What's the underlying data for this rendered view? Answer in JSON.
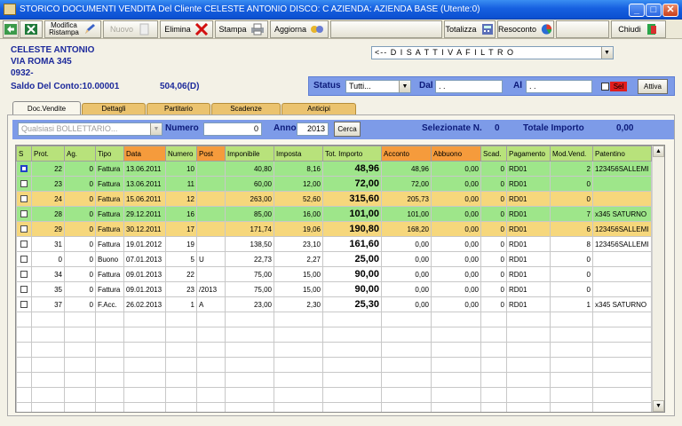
{
  "window": {
    "title": "STORICO DOCUMENTI VENDITA Del Cliente CELESTE ANTONIO   DISCO: C   AZIENDA: AZIENDA BASE (Utente:0)",
    "min": "_",
    "max": "□",
    "close": "✕"
  },
  "toolbar": {
    "modifica": "Modifica",
    "ristampa": "Ristampa",
    "nuovo": "Nuovo",
    "elimina": "Elimina",
    "stampa": "Stampa",
    "aggiorna": "Aggiorna",
    "totalizza": "Totalizza",
    "resoconto": "Resoconto",
    "chiudi": "Chiudi"
  },
  "customer": {
    "name": "CELESTE ANTONIO",
    "address": "VIA ROMA 345",
    "code": "0932-",
    "saldo_label": "Saldo Del Conto:10.00001",
    "saldo_value": "504,06(D)"
  },
  "filter_select": "<-- D I S A T T I V A   F I L T R O",
  "status_bar": {
    "status_label": "Status",
    "status_value": "Tutti...",
    "dal_label": "Dal",
    "dal_value": " .   .",
    "al_label": "Al",
    "al_value": " .   .",
    "sel_label": "Sel",
    "attiva": "Attiva"
  },
  "tabs": [
    "Doc.Vendite",
    "Dettagli",
    "Partitario",
    "Scadenze",
    "Anticipi"
  ],
  "doc_filter": {
    "tipo_placeholder": "Qualsiasi BOLLETTARIO...",
    "numero_label": "Numero",
    "numero_value": "0",
    "anno_label": "Anno",
    "anno_value": "2013",
    "cerca": "Cerca",
    "selezionate_label": "Selezionate N.",
    "selezionate_value": "0",
    "totale_label": "Totale Importo",
    "totale_value": "0,00"
  },
  "columns": [
    "S",
    "Prot.",
    "Ag.",
    "Tipo",
    "Data",
    "Numero",
    "Post",
    "Imponibile",
    "Imposta",
    "Tot. Importo",
    "Acconto",
    "Abbuono",
    "Scad.",
    "Pagamento",
    "Mod.Vend.",
    "Patentino"
  ],
  "header_colors": {
    "default": "#b8e27b",
    "orange": "#f59b3c",
    "blue": "#8ab4ea"
  },
  "row_colors": {
    "green": "#9ee68a",
    "yellow": "#f6d77c",
    "white": "#ffffff"
  },
  "rows": [
    {
      "color": "green",
      "prot": "22",
      "ag": "0",
      "tipo": "Fattura",
      "data": "13.06.2011",
      "numero": "10",
      "post": "",
      "imponibile": "40,80",
      "imposta": "8,16",
      "tot": "48,96",
      "acconto": "48,96",
      "abbuono": "0,00",
      "scad": "0",
      "pag": "RD01",
      "mod": "2",
      "pat": "123456SALLEMI"
    },
    {
      "color": "green",
      "prot": "23",
      "ag": "0",
      "tipo": "Fattura",
      "data": "13.06.2011",
      "numero": "11",
      "post": "",
      "imponibile": "60,00",
      "imposta": "12,00",
      "tot": "72,00",
      "acconto": "72,00",
      "abbuono": "0,00",
      "scad": "0",
      "pag": "RD01",
      "mod": "0",
      "pat": ""
    },
    {
      "color": "yellow",
      "prot": "24",
      "ag": "0",
      "tipo": "Fattura",
      "data": "15.06.2011",
      "numero": "12",
      "post": "",
      "imponibile": "263,00",
      "imposta": "52,60",
      "tot": "315,60",
      "acconto": "205,73",
      "abbuono": "0,00",
      "scad": "0",
      "pag": "RD01",
      "mod": "0",
      "pat": ""
    },
    {
      "color": "green",
      "prot": "28",
      "ag": "0",
      "tipo": "Fattura",
      "data": "29.12.2011",
      "numero": "16",
      "post": "",
      "imponibile": "85,00",
      "imposta": "16,00",
      "tot": "101,00",
      "acconto": "101,00",
      "abbuono": "0,00",
      "scad": "0",
      "pag": "RD01",
      "mod": "7",
      "pat": "x345 SATURNO"
    },
    {
      "color": "yellow",
      "prot": "29",
      "ag": "0",
      "tipo": "Fattura",
      "data": "30.12.2011",
      "numero": "17",
      "post": "",
      "imponibile": "171,74",
      "imposta": "19,06",
      "tot": "190,80",
      "acconto": "168,20",
      "abbuono": "0,00",
      "scad": "0",
      "pag": "RD01",
      "mod": "6",
      "pat": "123456SALLEMI"
    },
    {
      "color": "white",
      "prot": "31",
      "ag": "0",
      "tipo": "Fattura",
      "data": "19.01.2012",
      "numero": "19",
      "post": "",
      "imponibile": "138,50",
      "imposta": "23,10",
      "tot": "161,60",
      "acconto": "0,00",
      "abbuono": "0,00",
      "scad": "0",
      "pag": "RD01",
      "mod": "8",
      "pat": "123456SALLEMI"
    },
    {
      "color": "white",
      "prot": "0",
      "ag": "0",
      "tipo": "Buono",
      "data": "07.01.2013",
      "numero": "5",
      "post": "U",
      "imponibile": "22,73",
      "imposta": "2,27",
      "tot": "25,00",
      "acconto": "0,00",
      "abbuono": "0,00",
      "scad": "0",
      "pag": "RD01",
      "mod": "0",
      "pat": ""
    },
    {
      "color": "white",
      "prot": "34",
      "ag": "0",
      "tipo": "Fattura",
      "data": "09.01.2013",
      "numero": "22",
      "post": "",
      "imponibile": "75,00",
      "imposta": "15,00",
      "tot": "90,00",
      "acconto": "0,00",
      "abbuono": "0,00",
      "scad": "0",
      "pag": "RD01",
      "mod": "0",
      "pat": ""
    },
    {
      "color": "white",
      "prot": "35",
      "ag": "0",
      "tipo": "Fattura",
      "data": "09.01.2013",
      "numero": "23",
      "post": "/2013",
      "imponibile": "75,00",
      "imposta": "15,00",
      "tot": "90,00",
      "acconto": "0,00",
      "abbuono": "0,00",
      "scad": "0",
      "pag": "RD01",
      "mod": "0",
      "pat": ""
    },
    {
      "color": "white",
      "prot": "37",
      "ag": "0",
      "tipo": "F.Acc.",
      "data": "26.02.2013",
      "numero": "1",
      "post": "A",
      "imponibile": "23,00",
      "imposta": "2,30",
      "tot": "25,30",
      "acconto": "0,00",
      "abbuono": "0,00",
      "scad": "0",
      "pag": "RD01",
      "mod": "1",
      "pat": "x345 SATURNO"
    }
  ]
}
